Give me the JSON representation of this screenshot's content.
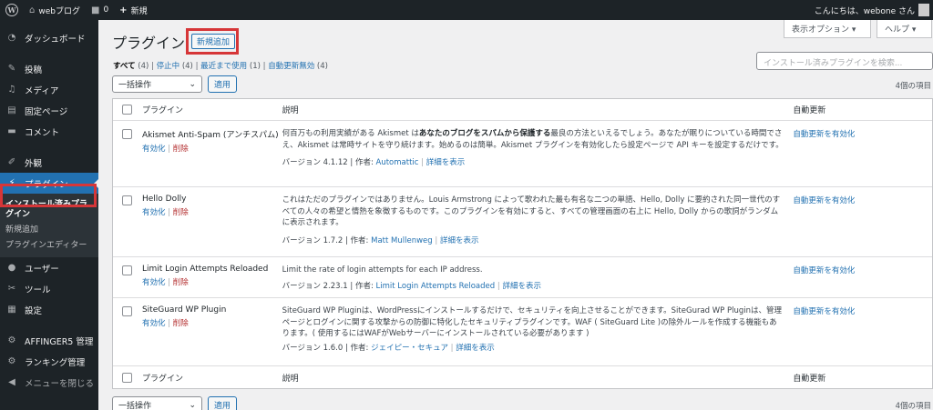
{
  "adminbar": {
    "site_name": "webブログ",
    "comments_count": "0",
    "new_label": "新規",
    "greeting": "こんにちは、webone さん"
  },
  "sidebar": {
    "items": [
      {
        "label": "ダッシュボード",
        "icon": "dashboard-icon"
      },
      {
        "label": "投稿",
        "icon": "pin-icon"
      },
      {
        "label": "メディア",
        "icon": "media-icon"
      },
      {
        "label": "固定ページ",
        "icon": "page-icon"
      },
      {
        "label": "コメント",
        "icon": "comment-icon"
      },
      {
        "label": "外観",
        "icon": "brush-icon"
      },
      {
        "label": "プラグイン",
        "icon": "plugin-icon"
      },
      {
        "label": "ユーザー",
        "icon": "user-icon"
      },
      {
        "label": "ツール",
        "icon": "wrench-icon"
      },
      {
        "label": "設定",
        "icon": "settings-icon"
      },
      {
        "label": "AFFINGER5 管理",
        "icon": "affinger-icon"
      },
      {
        "label": "ランキング管理",
        "icon": "ranking-icon"
      },
      {
        "label": "メニューを閉じる",
        "icon": "collapse-icon"
      }
    ],
    "submenu": [
      "インストール済みプラグイン",
      "新規追加",
      "プラグインエディター"
    ]
  },
  "header": {
    "title": "プラグイン",
    "add_new": "新規追加",
    "screen_options": "表示オプション ▾",
    "help": "ヘルプ ▾"
  },
  "filters": {
    "all": "すべて",
    "all_count": "(4)",
    "inactive": "停止中",
    "inactive_count": "(4)",
    "recent": "最近まで使用",
    "recent_count": "(1)",
    "auto_disabled": "自動更新無効",
    "auto_disabled_count": "(4)"
  },
  "search": {
    "placeholder": "インストール済みプラグインを検索..."
  },
  "bulk": {
    "select": "一括操作",
    "apply": "適用",
    "count": "4個の項目"
  },
  "table": {
    "col_plugin": "プラグイン",
    "col_desc": "説明",
    "col_auto": "自動更新",
    "rows": [
      {
        "name": "Akismet Anti-Spam (アンチスパム)",
        "activate": "有効化",
        "delete": "削除",
        "desc_a": "何百万もの利用実績がある Akismet は",
        "desc_b": "あなたのブログをスパムから保護する",
        "desc_c": "最良の方法といえるでしょう。あなたが眠りについている時間でさえ、Akismet は常時サイトを守り続けます。始めるのは簡単。Akismet プラグインを有効化したら設定ページで API キーを設定するだけです。",
        "version": "バージョン 4.1.12 | 作者: ",
        "author": "Automattic",
        "details": "詳細を表示",
        "auto": "自動更新を有効化"
      },
      {
        "name": "Hello Dolly",
        "activate": "有効化",
        "delete": "削除",
        "desc": "これはただのプラグインではありません。Louis Armstrong によって歌われた最も有名な二つの単語、Hello, Dolly に要約された同一世代のすべての人々の希望と情熱を象徴するものです。このプラグインを有効にすると、すべての管理画面の右上に Hello, Dolly からの歌詞がランダムに表示されます。",
        "version": "バージョン 1.7.2 | 作者: ",
        "author": "Matt Mullenweg",
        "details": "詳細を表示",
        "auto": "自動更新を有効化"
      },
      {
        "name": "Limit Login Attempts Reloaded",
        "activate": "有効化",
        "delete": "削除",
        "desc": "Limit the rate of login attempts for each IP address.",
        "version": "バージョン 2.23.1 | 作者: ",
        "author": "Limit Login Attempts Reloaded",
        "details": "詳細を表示",
        "auto": "自動更新を有効化"
      },
      {
        "name": "SiteGuard WP Plugin",
        "activate": "有効化",
        "delete": "削除",
        "desc": "SiteGuard WP Pluginは、WordPressにインストールするだけで、セキュリティを向上させることができます。SiteGurad WP Pluginは、管理ページとログインに関する攻撃からの防御に特化したセキュリティプラグインです。WAF ( SiteGuard Lite )の除外ルールを作成する機能もあります。( 使用するにはWAFがWebサーバーにインストールされている必要があります )",
        "version": "バージョン 1.6.0 | 作者: ",
        "author": "ジェイピー・セキュア",
        "details": "詳細を表示",
        "auto": "自動更新を有効化"
      }
    ]
  }
}
